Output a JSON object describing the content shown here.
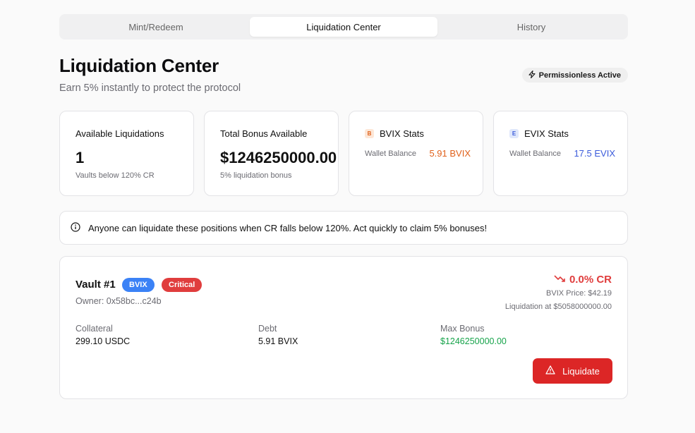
{
  "tabs": [
    {
      "label": "Mint/Redeem",
      "active": false
    },
    {
      "label": "Liquidation Center",
      "active": true
    },
    {
      "label": "History",
      "active": false
    }
  ],
  "header": {
    "title": "Liquidation Center",
    "subtitle": "Earn 5% instantly to protect the protocol",
    "badge": "Permissionless Active",
    "badge_icon": "lightning-icon"
  },
  "stats": {
    "available": {
      "label": "Available Liquidations",
      "value": "1",
      "note": "Vaults below 120% CR"
    },
    "bonus": {
      "label": "Total Bonus Available",
      "value": "$1246250000.00",
      "note": "5% liquidation bonus"
    },
    "bvix": {
      "icon_letter": "B",
      "label": "BVIX Stats",
      "wallet_label": "Wallet Balance",
      "wallet_value": "5.91 BVIX",
      "color": "#e0611b"
    },
    "evix": {
      "icon_letter": "E",
      "label": "EVIX Stats",
      "wallet_label": "Wallet Balance",
      "wallet_value": "17.5 EVIX",
      "color": "#3b5bdb"
    }
  },
  "info": {
    "icon": "info-icon",
    "text": "Anyone can liquidate these positions when CR falls below 120%. Act quickly to claim 5% bonuses!"
  },
  "vault": {
    "title": "Vault #1",
    "token_badge": "BVIX",
    "status_badge": "Critical",
    "owner": "Owner: 0x58bc...c24b",
    "cr": "0.0% CR",
    "cr_icon": "trending-down-icon",
    "price": "BVIX Price: $42.19",
    "liquidation_at": "Liquidation at $5058000000.00",
    "collateral_label": "Collateral",
    "collateral_value": "299.10 USDC",
    "debt_label": "Debt",
    "debt_value": "5.91 BVIX",
    "bonus_label": "Max Bonus",
    "bonus_value": "$1246250000.00",
    "button_label": "Liquidate",
    "button_icon": "warning-triangle-icon"
  },
  "colors": {
    "danger": "#dc2626",
    "success": "#16a34a",
    "primary": "#3b82f6"
  }
}
